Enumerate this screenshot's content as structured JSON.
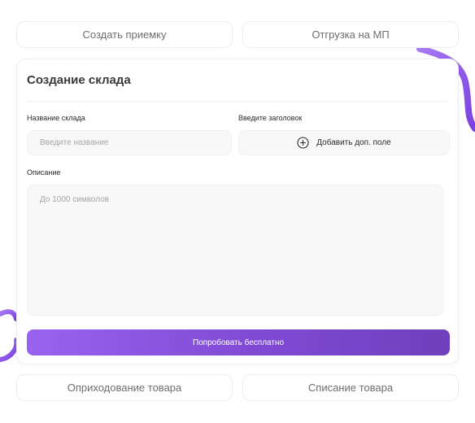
{
  "tabs_top": {
    "create_receipt": "Создать приемку",
    "mp_shipment": "Отгрузка на МП"
  },
  "form": {
    "title": "Создание склада",
    "name_label": "Название склада",
    "name_placeholder": "Введите название",
    "heading_label": "Введите заголовок",
    "add_field_label": "Добавить доп. поле",
    "description_label": "Описание",
    "description_placeholder": "До 1000 символов",
    "submit_label": "Попробовать бесплатно"
  },
  "tabs_bottom": {
    "goods_receipt": "Оприходование товара",
    "goods_writeoff": "Списание товара"
  },
  "colors": {
    "accent_start": "#9a62f0",
    "accent_end": "#6f3fbd"
  },
  "icons": {
    "add_field": "plus-circle-icon"
  }
}
